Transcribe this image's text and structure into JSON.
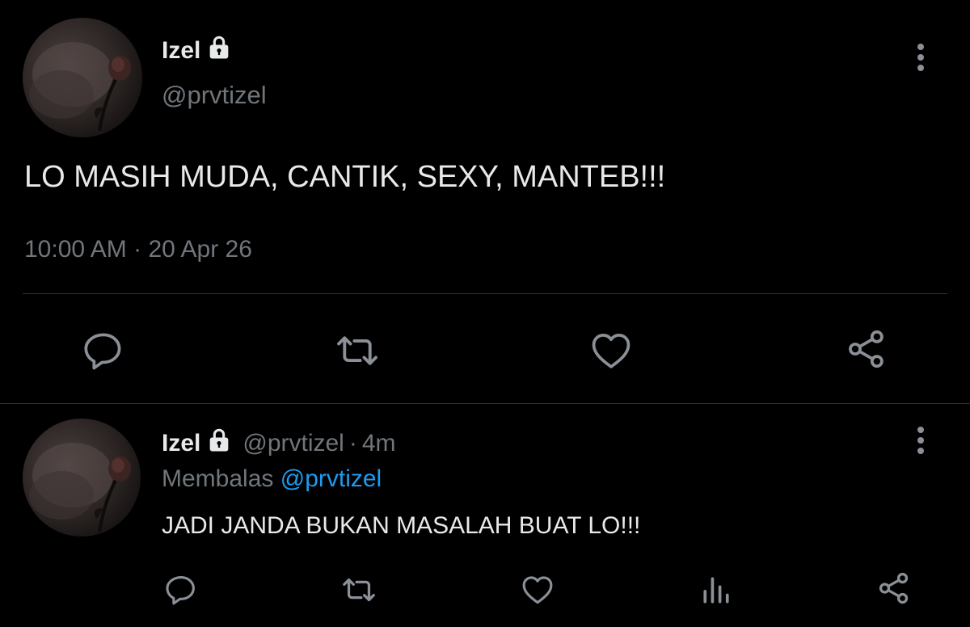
{
  "main_tweet": {
    "display_name": "Izel",
    "handle": "@prvtizel",
    "text": "LO MASIH MUDA, CANTIK, SEXY, MANTEB!!!",
    "time": "10:00 AM",
    "separator": "·",
    "date": "20 Apr 26",
    "actions": {
      "reply_icon": "reply-icon",
      "retweet_icon": "retweet-icon",
      "like_icon": "heart-icon",
      "share_icon": "share-icon"
    },
    "more_icon": "more-vertical-icon"
  },
  "reply_tweet": {
    "display_name": "Izel",
    "handle": "@prvtizel",
    "separator": "·",
    "age": "4m",
    "replying_label": "Membalas",
    "replying_to": "@prvtizel",
    "text": "JADI JANDA BUKAN MASALAH BUAT LO!!!",
    "actions": {
      "reply_icon": "reply-icon",
      "retweet_icon": "retweet-icon",
      "like_icon": "heart-icon",
      "analytics_icon": "analytics-icon",
      "share_icon": "share-icon"
    },
    "more_icon": "more-vertical-icon"
  },
  "colors": {
    "background": "#000000",
    "text_primary": "#e7e9ea",
    "text_muted": "#71767b",
    "link": "#1d9bf0",
    "divider": "#2f3336"
  }
}
